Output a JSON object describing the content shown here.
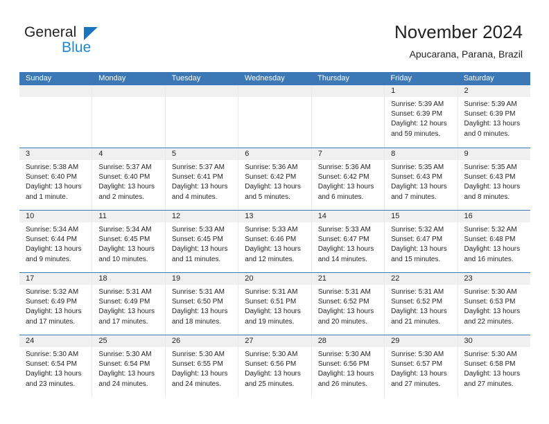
{
  "brand": {
    "line1": "General",
    "line2": "Blue",
    "logo_icon": "general-blue-triangle-icon",
    "color_dark": "#231f20",
    "color_blue": "#1c87d6"
  },
  "header": {
    "title": "November 2024",
    "subtitle": "Apucarana, Parana, Brazil"
  },
  "theme": {
    "header_blue": "#3b78b5",
    "daynum_bg": "#f0f0f0",
    "cell_border": "#e9e9e9",
    "text": "#231f20"
  },
  "calendar": {
    "weekday_headers": [
      "Sunday",
      "Monday",
      "Tuesday",
      "Wednesday",
      "Thursday",
      "Friday",
      "Saturday"
    ],
    "weeks": [
      [
        {
          "day": "",
          "sunrise": "",
          "sunset": "",
          "daylight": "",
          "empty": true
        },
        {
          "day": "",
          "sunrise": "",
          "sunset": "",
          "daylight": "",
          "empty": true
        },
        {
          "day": "",
          "sunrise": "",
          "sunset": "",
          "daylight": "",
          "empty": true
        },
        {
          "day": "",
          "sunrise": "",
          "sunset": "",
          "daylight": "",
          "empty": true
        },
        {
          "day": "",
          "sunrise": "",
          "sunset": "",
          "daylight": "",
          "empty": true
        },
        {
          "day": "1",
          "sunrise": "Sunrise: 5:39 AM",
          "sunset": "Sunset: 6:39 PM",
          "daylight": "Daylight: 12 hours and 59 minutes."
        },
        {
          "day": "2",
          "sunrise": "Sunrise: 5:39 AM",
          "sunset": "Sunset: 6:39 PM",
          "daylight": "Daylight: 13 hours and 0 minutes."
        }
      ],
      [
        {
          "day": "3",
          "sunrise": "Sunrise: 5:38 AM",
          "sunset": "Sunset: 6:40 PM",
          "daylight": "Daylight: 13 hours and 1 minute."
        },
        {
          "day": "4",
          "sunrise": "Sunrise: 5:37 AM",
          "sunset": "Sunset: 6:40 PM",
          "daylight": "Daylight: 13 hours and 2 minutes."
        },
        {
          "day": "5",
          "sunrise": "Sunrise: 5:37 AM",
          "sunset": "Sunset: 6:41 PM",
          "daylight": "Daylight: 13 hours and 4 minutes."
        },
        {
          "day": "6",
          "sunrise": "Sunrise: 5:36 AM",
          "sunset": "Sunset: 6:42 PM",
          "daylight": "Daylight: 13 hours and 5 minutes."
        },
        {
          "day": "7",
          "sunrise": "Sunrise: 5:36 AM",
          "sunset": "Sunset: 6:42 PM",
          "daylight": "Daylight: 13 hours and 6 minutes."
        },
        {
          "day": "8",
          "sunrise": "Sunrise: 5:35 AM",
          "sunset": "Sunset: 6:43 PM",
          "daylight": "Daylight: 13 hours and 7 minutes."
        },
        {
          "day": "9",
          "sunrise": "Sunrise: 5:35 AM",
          "sunset": "Sunset: 6:43 PM",
          "daylight": "Daylight: 13 hours and 8 minutes."
        }
      ],
      [
        {
          "day": "10",
          "sunrise": "Sunrise: 5:34 AM",
          "sunset": "Sunset: 6:44 PM",
          "daylight": "Daylight: 13 hours and 9 minutes."
        },
        {
          "day": "11",
          "sunrise": "Sunrise: 5:34 AM",
          "sunset": "Sunset: 6:45 PM",
          "daylight": "Daylight: 13 hours and 10 minutes."
        },
        {
          "day": "12",
          "sunrise": "Sunrise: 5:33 AM",
          "sunset": "Sunset: 6:45 PM",
          "daylight": "Daylight: 13 hours and 11 minutes."
        },
        {
          "day": "13",
          "sunrise": "Sunrise: 5:33 AM",
          "sunset": "Sunset: 6:46 PM",
          "daylight": "Daylight: 13 hours and 12 minutes."
        },
        {
          "day": "14",
          "sunrise": "Sunrise: 5:33 AM",
          "sunset": "Sunset: 6:47 PM",
          "daylight": "Daylight: 13 hours and 14 minutes."
        },
        {
          "day": "15",
          "sunrise": "Sunrise: 5:32 AM",
          "sunset": "Sunset: 6:47 PM",
          "daylight": "Daylight: 13 hours and 15 minutes."
        },
        {
          "day": "16",
          "sunrise": "Sunrise: 5:32 AM",
          "sunset": "Sunset: 6:48 PM",
          "daylight": "Daylight: 13 hours and 16 minutes."
        }
      ],
      [
        {
          "day": "17",
          "sunrise": "Sunrise: 5:32 AM",
          "sunset": "Sunset: 6:49 PM",
          "daylight": "Daylight: 13 hours and 17 minutes."
        },
        {
          "day": "18",
          "sunrise": "Sunrise: 5:31 AM",
          "sunset": "Sunset: 6:49 PM",
          "daylight": "Daylight: 13 hours and 17 minutes."
        },
        {
          "day": "19",
          "sunrise": "Sunrise: 5:31 AM",
          "sunset": "Sunset: 6:50 PM",
          "daylight": "Daylight: 13 hours and 18 minutes."
        },
        {
          "day": "20",
          "sunrise": "Sunrise: 5:31 AM",
          "sunset": "Sunset: 6:51 PM",
          "daylight": "Daylight: 13 hours and 19 minutes."
        },
        {
          "day": "21",
          "sunrise": "Sunrise: 5:31 AM",
          "sunset": "Sunset: 6:52 PM",
          "daylight": "Daylight: 13 hours and 20 minutes."
        },
        {
          "day": "22",
          "sunrise": "Sunrise: 5:31 AM",
          "sunset": "Sunset: 6:52 PM",
          "daylight": "Daylight: 13 hours and 21 minutes."
        },
        {
          "day": "23",
          "sunrise": "Sunrise: 5:30 AM",
          "sunset": "Sunset: 6:53 PM",
          "daylight": "Daylight: 13 hours and 22 minutes."
        }
      ],
      [
        {
          "day": "24",
          "sunrise": "Sunrise: 5:30 AM",
          "sunset": "Sunset: 6:54 PM",
          "daylight": "Daylight: 13 hours and 23 minutes."
        },
        {
          "day": "25",
          "sunrise": "Sunrise: 5:30 AM",
          "sunset": "Sunset: 6:54 PM",
          "daylight": "Daylight: 13 hours and 24 minutes."
        },
        {
          "day": "26",
          "sunrise": "Sunrise: 5:30 AM",
          "sunset": "Sunset: 6:55 PM",
          "daylight": "Daylight: 13 hours and 24 minutes."
        },
        {
          "day": "27",
          "sunrise": "Sunrise: 5:30 AM",
          "sunset": "Sunset: 6:56 PM",
          "daylight": "Daylight: 13 hours and 25 minutes."
        },
        {
          "day": "28",
          "sunrise": "Sunrise: 5:30 AM",
          "sunset": "Sunset: 6:56 PM",
          "daylight": "Daylight: 13 hours and 26 minutes."
        },
        {
          "day": "29",
          "sunrise": "Sunrise: 5:30 AM",
          "sunset": "Sunset: 6:57 PM",
          "daylight": "Daylight: 13 hours and 27 minutes."
        },
        {
          "day": "30",
          "sunrise": "Sunrise: 5:30 AM",
          "sunset": "Sunset: 6:58 PM",
          "daylight": "Daylight: 13 hours and 27 minutes."
        }
      ]
    ]
  }
}
